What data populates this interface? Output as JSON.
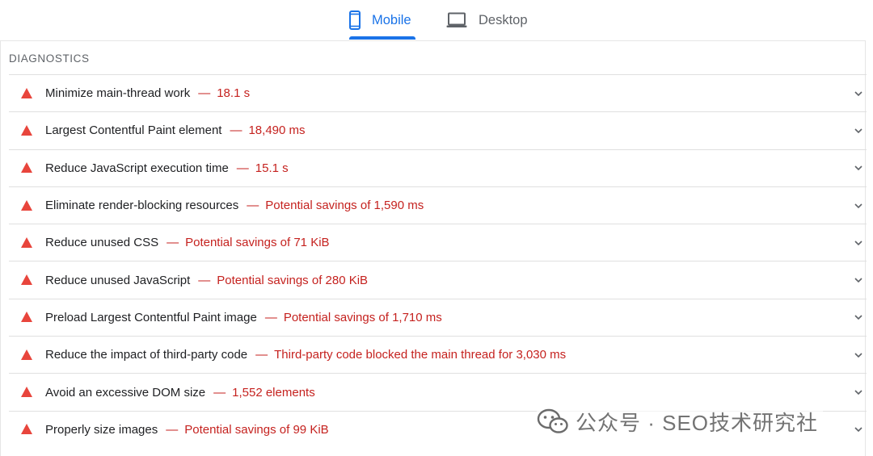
{
  "tabs": {
    "mobile": {
      "label": "Mobile",
      "icon": "smartphone-icon",
      "active": true,
      "color": "#1a73e8"
    },
    "desktop": {
      "label": "Desktop",
      "icon": "laptop-icon",
      "active": false
    }
  },
  "section": {
    "title": "DIAGNOSTICS"
  },
  "audits": [
    {
      "title": "Minimize main-thread work",
      "value": "18.1 s"
    },
    {
      "title": "Largest Contentful Paint element",
      "value": "18,490 ms"
    },
    {
      "title": "Reduce JavaScript execution time",
      "value": "15.1 s"
    },
    {
      "title": "Eliminate render-blocking resources",
      "value": "Potential savings of 1,590 ms"
    },
    {
      "title": "Reduce unused CSS",
      "value": "Potential savings of 71 KiB"
    },
    {
      "title": "Reduce unused JavaScript",
      "value": "Potential savings of 280 KiB"
    },
    {
      "title": "Preload Largest Contentful Paint image",
      "value": "Potential savings of 1,710 ms"
    },
    {
      "title": "Reduce the impact of third-party code",
      "value": "Third-party code blocked the main thread for 3,030 ms"
    },
    {
      "title": "Avoid an excessive DOM size",
      "value": "1,552 elements"
    },
    {
      "title": "Properly size images",
      "value": "Potential savings of 99 KiB"
    }
  ],
  "separator": "—",
  "colors": {
    "warning": "#e8453c",
    "value_text": "#c5221f",
    "accent": "#1a73e8"
  },
  "watermark": {
    "text": "公众号 · SEO技术研究社",
    "icon": "wechat-icon"
  }
}
